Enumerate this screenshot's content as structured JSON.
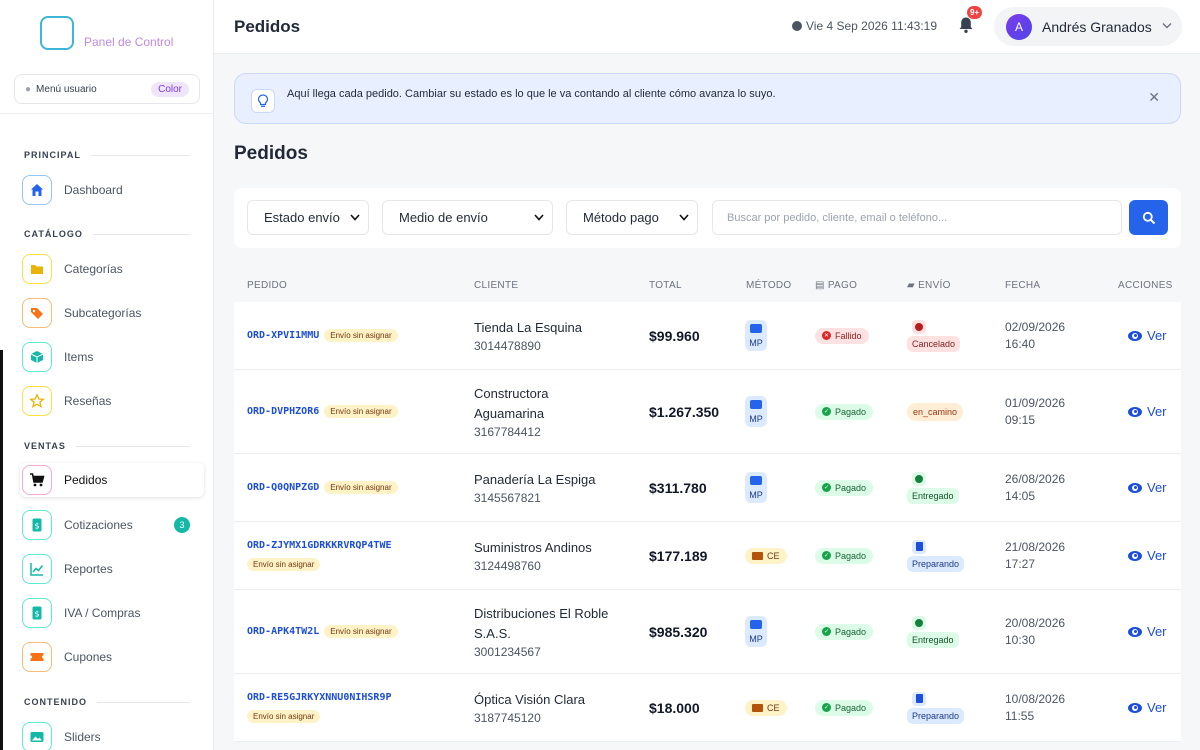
{
  "sidebar": {
    "logo_text": "Panel de Control",
    "user_menu": {
      "label": "Menú usuario",
      "chip": "Color"
    },
    "sections": [
      {
        "label": "PRINCIPAL"
      },
      {
        "label": "CATÁLOGO"
      },
      {
        "label": "VENTAS"
      },
      {
        "label": "CONTENIDO"
      }
    ],
    "items": [
      {
        "label": "Dashboard",
        "icon": "home-icon",
        "color": "#2563eb"
      },
      {
        "label": "Categorías",
        "icon": "folder-icon",
        "color": "#eab308"
      },
      {
        "label": "Subcategorías",
        "icon": "tag-icon",
        "color": "#f97316"
      },
      {
        "label": "Items",
        "icon": "box-icon",
        "color": "#14b8a6"
      },
      {
        "label": "Reseñas",
        "icon": "star-icon",
        "color": "#eab308"
      },
      {
        "label": "Pedidos",
        "icon": "cart-icon",
        "color": "#111111",
        "active": true
      },
      {
        "label": "Cotizaciones",
        "icon": "invoice-icon",
        "color": "#14b8a6",
        "badge": "3"
      },
      {
        "label": "Reportes",
        "icon": "chart-icon",
        "color": "#14b8a6"
      },
      {
        "label": "IVA / Compras",
        "icon": "receipt-icon",
        "color": "#14b8a6"
      },
      {
        "label": "Cupones",
        "icon": "coupon-icon",
        "color": "#f97316"
      },
      {
        "label": "Sliders",
        "icon": "image-icon",
        "color": "#14b8a6"
      }
    ]
  },
  "header": {
    "title": "Pedidos",
    "datetime": "Vie 4 Sep 2026 11:43:19",
    "notifications": "9+",
    "user": {
      "initial": "A",
      "name": "Andrés Granados"
    }
  },
  "alert": {
    "message": "Aquí llega cada pedido. Cambiar su estado es lo que le va contando al cliente cómo avanza lo suyo."
  },
  "page": {
    "title": "Pedidos"
  },
  "filters": {
    "estado_envio": "Estado envío",
    "medio_envio": "Medio de envío",
    "metodo_pago": "Método pago",
    "search_placeholder": "Buscar por pedido, cliente, email o teléfono..."
  },
  "table": {
    "headers": {
      "pedido": "PEDIDO",
      "cliente": "CLIENTE",
      "total": "TOTAL",
      "metodo": "MÉTODO",
      "pago": "PAGO",
      "envio": "ENVÍO",
      "fecha": "FECHA",
      "acciones": "ACCIONES"
    },
    "unassigned_label": "Envío sin asignar",
    "action_label": "Ver",
    "rows": [
      {
        "id": "ORD-XPVI1MMU",
        "client_lines": [
          "Tienda La Esquina"
        ],
        "phone": "3014478890",
        "total": "$99.960",
        "method": "MP",
        "payment": "Fallido",
        "payment_status": "fail",
        "shipping": "Cancelado",
        "shipping_status": "cancel",
        "date": "02/09/2026",
        "time": "16:40"
      },
      {
        "id": "ORD-DVPHZOR6",
        "client_lines": [
          "Constructora",
          "Aguamarina"
        ],
        "phone": "3167784412",
        "total": "$1.267.350",
        "method": "MP",
        "payment": "Pagado",
        "payment_status": "ok",
        "shipping": "en_camino",
        "shipping_status": "transit",
        "date": "01/09/2026",
        "time": "09:15"
      },
      {
        "id": "ORD-Q0QNPZGD",
        "client_lines": [
          "Panadería La Espiga"
        ],
        "phone": "3145567821",
        "total": "$311.780",
        "method": "MP",
        "payment": "Pagado",
        "payment_status": "ok",
        "shipping": "Entregado",
        "shipping_status": "done",
        "date": "26/08/2026",
        "time": "14:05"
      },
      {
        "id": "ORD-ZJYMX1GDRKKRVRQP4TWE",
        "client_lines": [
          "Suministros Andinos"
        ],
        "phone": "3124498760",
        "total": "$177.189",
        "method": "CE",
        "payment": "Pagado",
        "payment_status": "ok",
        "shipping": "Preparando",
        "shipping_status": "prep",
        "date": "21/08/2026",
        "time": "17:27"
      },
      {
        "id": "ORD-APK4TW2L",
        "client_lines": [
          "Distribuciones El Roble",
          "S.A.S."
        ],
        "phone": "3001234567",
        "total": "$985.320",
        "method": "MP",
        "payment": "Pagado",
        "payment_status": "ok",
        "shipping": "Entregado",
        "shipping_status": "done",
        "date": "20/08/2026",
        "time": "10:30"
      },
      {
        "id": "ORD-RE5GJRKYXNNU0NIHSR9P",
        "client_lines": [
          "Óptica Visión Clara"
        ],
        "phone": "3187745120",
        "total": "$18.000",
        "method": "CE",
        "payment": "Pagado",
        "payment_status": "ok",
        "shipping": "Preparando",
        "shipping_status": "prep",
        "date": "10/08/2026",
        "time": "11:55"
      }
    ]
  }
}
